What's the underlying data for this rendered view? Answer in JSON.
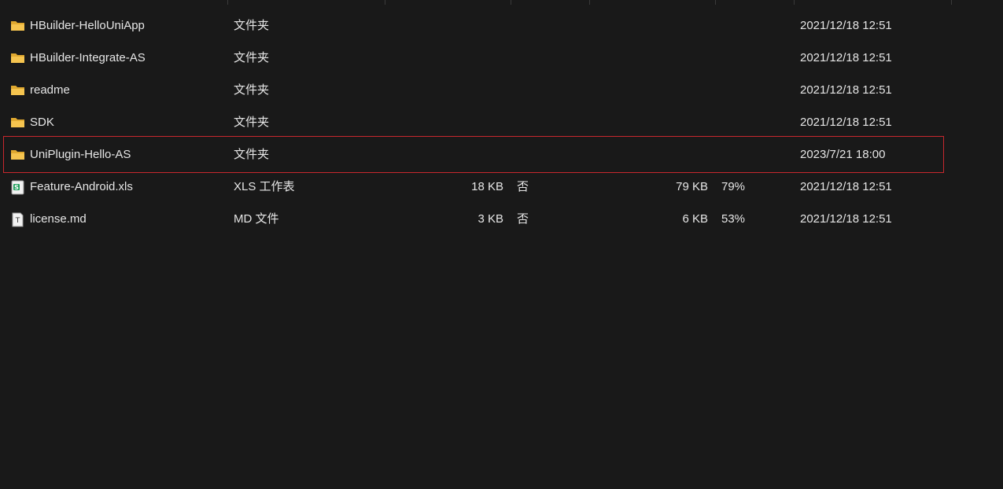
{
  "file_list": {
    "rows": [
      {
        "name": "HBuilder-HelloUniApp",
        "icon": "folder-icon",
        "type": "文件夹",
        "size": "",
        "encrypted": "",
        "original_size": "",
        "ratio": "",
        "modified": "2021/12/18 12:51",
        "selected": false
      },
      {
        "name": "HBuilder-Integrate-AS",
        "icon": "folder-icon",
        "type": "文件夹",
        "size": "",
        "encrypted": "",
        "original_size": "",
        "ratio": "",
        "modified": "2021/12/18 12:51",
        "selected": false
      },
      {
        "name": "readme",
        "icon": "folder-icon",
        "type": "文件夹",
        "size": "",
        "encrypted": "",
        "original_size": "",
        "ratio": "",
        "modified": "2021/12/18 12:51",
        "selected": false
      },
      {
        "name": "SDK",
        "icon": "folder-icon",
        "type": "文件夹",
        "size": "",
        "encrypted": "",
        "original_size": "",
        "ratio": "",
        "modified": "2021/12/18 12:51",
        "selected": false
      },
      {
        "name": "UniPlugin-Hello-AS",
        "icon": "folder-icon",
        "type": "文件夹",
        "size": "",
        "encrypted": "",
        "original_size": "",
        "ratio": "",
        "modified": "2023/7/21 18:00",
        "selected": true
      },
      {
        "name": "Feature-Android.xls",
        "icon": "spreadsheet-icon",
        "type": "XLS 工作表",
        "size": "18 KB",
        "encrypted": "否",
        "original_size": "79 KB",
        "ratio": "79%",
        "modified": "2021/12/18 12:51",
        "selected": false
      },
      {
        "name": "license.md",
        "icon": "text-file-icon",
        "type": "MD 文件",
        "size": "3 KB",
        "encrypted": "否",
        "original_size": "6 KB",
        "ratio": "53%",
        "modified": "2021/12/18 12:51",
        "selected": false
      }
    ]
  },
  "colors": {
    "background": "#191919",
    "text": "#e6e6e6",
    "highlight_border": "#c8282d",
    "folder": "#f5c44f",
    "spreadsheet": "#1e9e5a"
  }
}
